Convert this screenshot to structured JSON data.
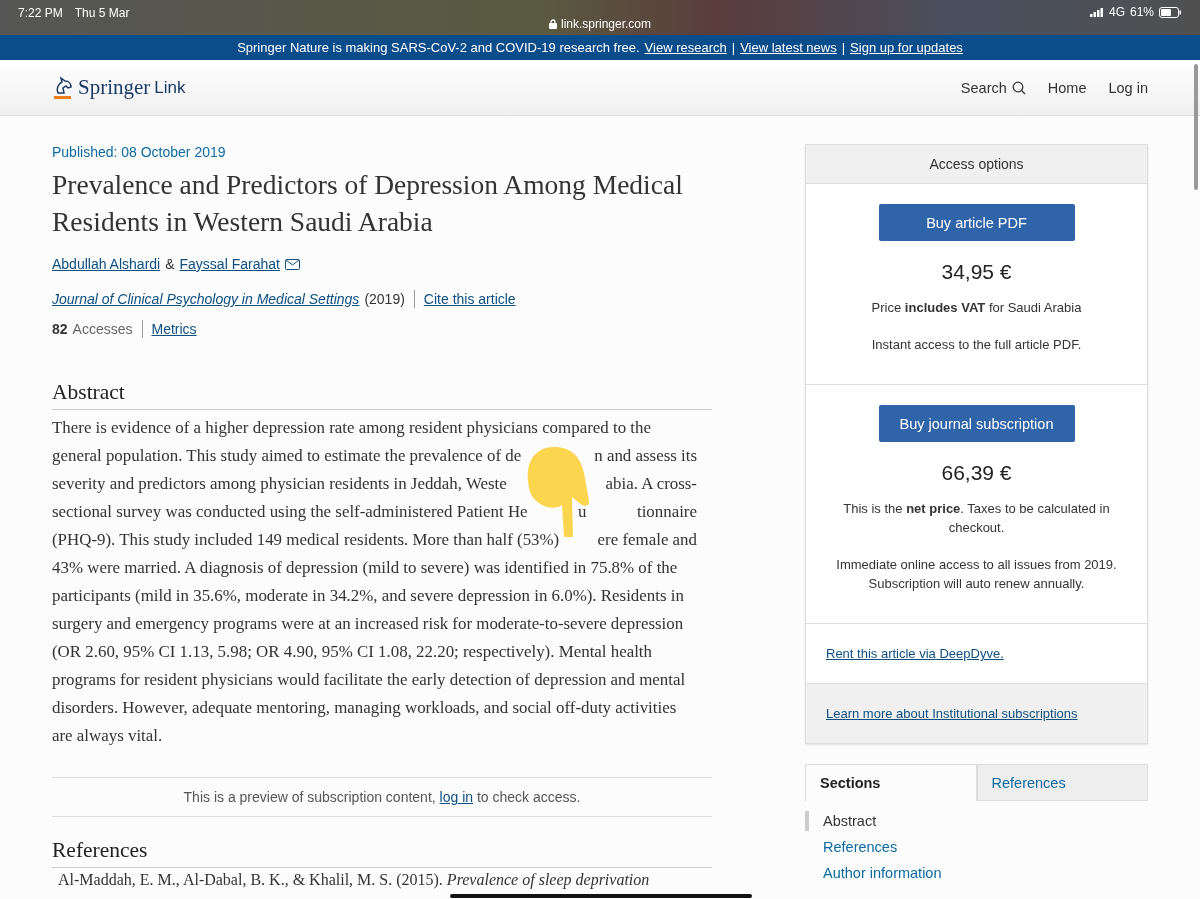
{
  "status_bar": {
    "time": "7:22 PM",
    "date": "Thu 5 Mar",
    "url": "link.springer.com",
    "network": "4G",
    "battery": "61%"
  },
  "banner": {
    "lead": "Springer Nature is making SARS-CoV-2 and COVID-19 research free.",
    "separator": "|",
    "links": [
      "View research",
      "View latest news",
      "Sign up for updates"
    ]
  },
  "header": {
    "logo": {
      "brand": "Springer",
      "sub": "Link"
    },
    "nav": [
      {
        "label": "Search",
        "kind": "search"
      },
      {
        "label": "Home",
        "kind": "link"
      },
      {
        "label": "Log in",
        "kind": "link"
      }
    ]
  },
  "article": {
    "published": "Published: 08 October 2019",
    "title": "Prevalence and Predictors of Depression Among Medical Residents in Western Saudi Arabia",
    "authors": [
      {
        "name": "Abdullah Alshardi",
        "email": false
      },
      {
        "name": "Fayssal Farahat",
        "email": true
      }
    ],
    "author_joiner": "&",
    "journal": {
      "name": "Journal of Clinical Psychology in Medical Settings",
      "year": "(2019)"
    },
    "cite": "Cite this article",
    "accesses": {
      "count": "82",
      "label": "Accesses"
    },
    "metrics": "Metrics"
  },
  "abstract": {
    "heading": "Abstract",
    "lines": [
      [
        "There is evidence of a higher depression rate among resident physicians compared to the"
      ],
      [
        "general population. This study aimed to estimate the prevalence of de",
        "n and assess its"
      ],
      [
        "severity and predictors among physician residents in Jeddah, Weste",
        "abia. A cross-"
      ],
      [
        "sectional survey was conducted using the self-administered Patient He",
        "u",
        "tionnaire"
      ],
      [
        "(PHQ-9). This study included 149 medical residents. More than half (53%)",
        "ere female and"
      ],
      [
        "43% were married. A diagnosis of depression (mild to severe) was identified in 75.8% of the"
      ],
      [
        "participants (mild in 35.6%, moderate in 34.2%, and severe depression in 6.0%). Residents in"
      ],
      [
        "surgery and emergency programs were at an increased risk for moderate-to-severe depression"
      ],
      [
        "(OR 2.60, 95% CI 1.13, 5.98; OR 4.90, 95% CI 1.08, 22.20; respectively). Mental health"
      ],
      [
        "programs for resident physicians would facilitate the early detection of depression and mental"
      ],
      [
        "disorders. However, adequate mentoring, managing workloads, and social off-duty activities"
      ],
      [
        "are always vital."
      ]
    ]
  },
  "preview": {
    "before": "This is a preview of subscription content,",
    "link": "log in",
    "after": "to check access."
  },
  "references": {
    "heading": "References",
    "items": [
      "Al-Maddah, E. M., Al-Dabal, B. K., & Khalil, M. S. (2015). *Prevalence of sleep deprivation*"
    ]
  },
  "access_options": {
    "title": "Access options",
    "options": [
      {
        "button": "Buy article PDF",
        "price": "34,95 €",
        "notes": [
          "Price **includes VAT** for Saudi Arabia",
          "Instant access to the full article PDF."
        ]
      },
      {
        "button": "Buy journal subscription",
        "price": "66,39 €",
        "notes": [
          "This is the **net price**. Taxes to be calculated in checkout.",
          "Immediate online access to all issues from 2019. Subscription will auto renew annually."
        ]
      }
    ],
    "rent_link": "Rent this article via DeepDyve.",
    "institutional_link": "Learn more about Institutional subscriptions"
  },
  "side_tabs": [
    {
      "label": "Sections",
      "selected": true
    },
    {
      "label": "References",
      "selected": false
    }
  ],
  "sections": [
    {
      "label": "Abstract",
      "selected": true
    },
    {
      "label": "References",
      "selected": false
    },
    {
      "label": "Author information",
      "selected": false
    }
  ]
}
